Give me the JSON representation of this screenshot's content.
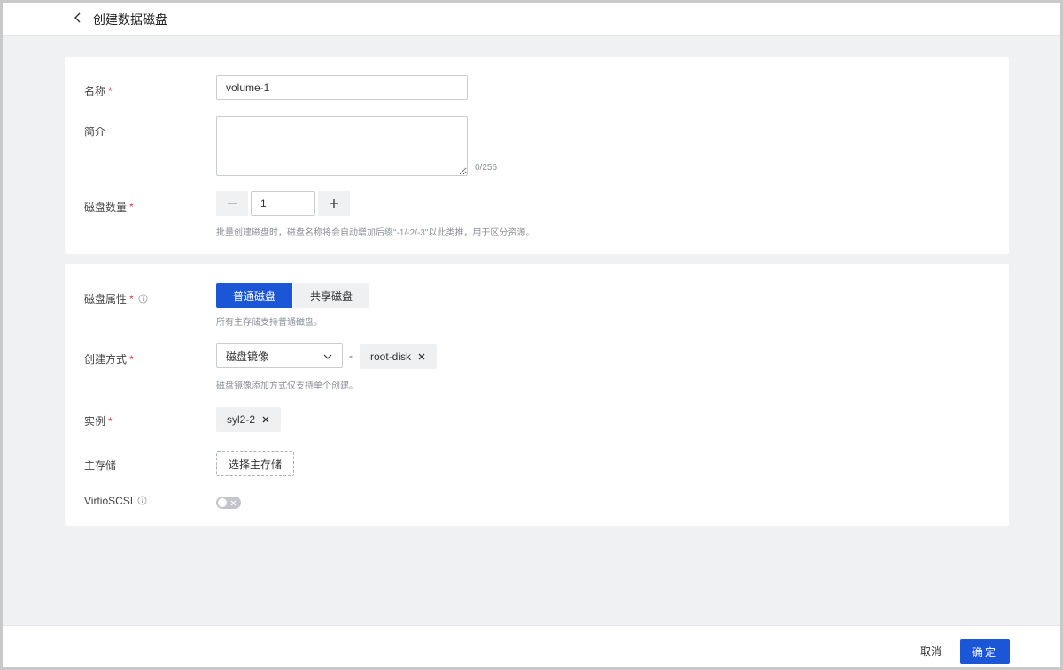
{
  "header": {
    "title": "创建数据磁盘"
  },
  "basic": {
    "name_label": "名称",
    "name_value": "volume-1",
    "desc_label": "简介",
    "desc_value": "",
    "desc_counter": "0/256",
    "count_label": "磁盘数量",
    "count_value": "1",
    "count_hint": "批量创建磁盘时，磁盘名称将会自动增加后缀\"-1/-2/-3\"以此类推，用于区分资源。"
  },
  "advanced": {
    "attr_label": "磁盘属性",
    "attr_options": [
      "普通磁盘",
      "共享磁盘"
    ],
    "attr_selected": "普通磁盘",
    "attr_hint": "所有主存储支持普通磁盘。",
    "method_label": "创建方式",
    "method_value": "磁盘镜像",
    "image_tag": "root-disk",
    "method_hint": "磁盘镜像添加方式仅支持单个创建。",
    "instance_label": "实例",
    "instance_tag": "syl2-2",
    "storage_label": "主存储",
    "storage_button": "选择主存储",
    "virtio_label": "VirtioSCSI",
    "virtio_enabled": false
  },
  "footer": {
    "cancel_label": "取消",
    "confirm_label": "确定"
  },
  "colors": {
    "primary": "#1a56d6",
    "required": "#e0363c",
    "background": "#f0f1f3"
  },
  "icons": [
    "back-arrow-icon",
    "info-icon",
    "minus-icon",
    "plus-icon",
    "chevron-down-icon",
    "close-icon"
  ]
}
